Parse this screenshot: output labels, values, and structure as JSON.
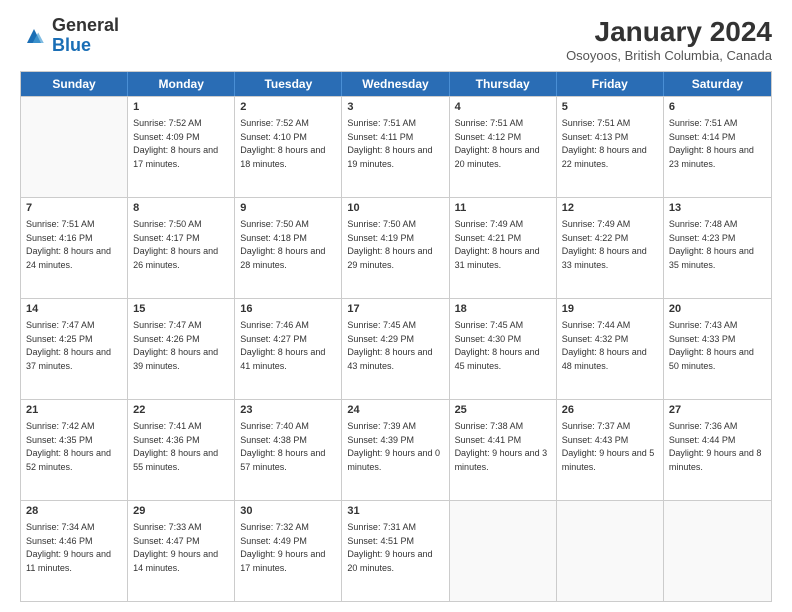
{
  "header": {
    "logo_general": "General",
    "logo_blue": "Blue",
    "month_title": "January 2024",
    "subtitle": "Osoyoos, British Columbia, Canada"
  },
  "weekdays": [
    "Sunday",
    "Monday",
    "Tuesday",
    "Wednesday",
    "Thursday",
    "Friday",
    "Saturday"
  ],
  "rows": [
    [
      {
        "day": "",
        "sunrise": "",
        "sunset": "",
        "daylight": ""
      },
      {
        "day": "1",
        "sunrise": "Sunrise: 7:52 AM",
        "sunset": "Sunset: 4:09 PM",
        "daylight": "Daylight: 8 hours and 17 minutes."
      },
      {
        "day": "2",
        "sunrise": "Sunrise: 7:52 AM",
        "sunset": "Sunset: 4:10 PM",
        "daylight": "Daylight: 8 hours and 18 minutes."
      },
      {
        "day": "3",
        "sunrise": "Sunrise: 7:51 AM",
        "sunset": "Sunset: 4:11 PM",
        "daylight": "Daylight: 8 hours and 19 minutes."
      },
      {
        "day": "4",
        "sunrise": "Sunrise: 7:51 AM",
        "sunset": "Sunset: 4:12 PM",
        "daylight": "Daylight: 8 hours and 20 minutes."
      },
      {
        "day": "5",
        "sunrise": "Sunrise: 7:51 AM",
        "sunset": "Sunset: 4:13 PM",
        "daylight": "Daylight: 8 hours and 22 minutes."
      },
      {
        "day": "6",
        "sunrise": "Sunrise: 7:51 AM",
        "sunset": "Sunset: 4:14 PM",
        "daylight": "Daylight: 8 hours and 23 minutes."
      }
    ],
    [
      {
        "day": "7",
        "sunrise": "Sunrise: 7:51 AM",
        "sunset": "Sunset: 4:16 PM",
        "daylight": "Daylight: 8 hours and 24 minutes."
      },
      {
        "day": "8",
        "sunrise": "Sunrise: 7:50 AM",
        "sunset": "Sunset: 4:17 PM",
        "daylight": "Daylight: 8 hours and 26 minutes."
      },
      {
        "day": "9",
        "sunrise": "Sunrise: 7:50 AM",
        "sunset": "Sunset: 4:18 PM",
        "daylight": "Daylight: 8 hours and 28 minutes."
      },
      {
        "day": "10",
        "sunrise": "Sunrise: 7:50 AM",
        "sunset": "Sunset: 4:19 PM",
        "daylight": "Daylight: 8 hours and 29 minutes."
      },
      {
        "day": "11",
        "sunrise": "Sunrise: 7:49 AM",
        "sunset": "Sunset: 4:21 PM",
        "daylight": "Daylight: 8 hours and 31 minutes."
      },
      {
        "day": "12",
        "sunrise": "Sunrise: 7:49 AM",
        "sunset": "Sunset: 4:22 PM",
        "daylight": "Daylight: 8 hours and 33 minutes."
      },
      {
        "day": "13",
        "sunrise": "Sunrise: 7:48 AM",
        "sunset": "Sunset: 4:23 PM",
        "daylight": "Daylight: 8 hours and 35 minutes."
      }
    ],
    [
      {
        "day": "14",
        "sunrise": "Sunrise: 7:47 AM",
        "sunset": "Sunset: 4:25 PM",
        "daylight": "Daylight: 8 hours and 37 minutes."
      },
      {
        "day": "15",
        "sunrise": "Sunrise: 7:47 AM",
        "sunset": "Sunset: 4:26 PM",
        "daylight": "Daylight: 8 hours and 39 minutes."
      },
      {
        "day": "16",
        "sunrise": "Sunrise: 7:46 AM",
        "sunset": "Sunset: 4:27 PM",
        "daylight": "Daylight: 8 hours and 41 minutes."
      },
      {
        "day": "17",
        "sunrise": "Sunrise: 7:45 AM",
        "sunset": "Sunset: 4:29 PM",
        "daylight": "Daylight: 8 hours and 43 minutes."
      },
      {
        "day": "18",
        "sunrise": "Sunrise: 7:45 AM",
        "sunset": "Sunset: 4:30 PM",
        "daylight": "Daylight: 8 hours and 45 minutes."
      },
      {
        "day": "19",
        "sunrise": "Sunrise: 7:44 AM",
        "sunset": "Sunset: 4:32 PM",
        "daylight": "Daylight: 8 hours and 48 minutes."
      },
      {
        "day": "20",
        "sunrise": "Sunrise: 7:43 AM",
        "sunset": "Sunset: 4:33 PM",
        "daylight": "Daylight: 8 hours and 50 minutes."
      }
    ],
    [
      {
        "day": "21",
        "sunrise": "Sunrise: 7:42 AM",
        "sunset": "Sunset: 4:35 PM",
        "daylight": "Daylight: 8 hours and 52 minutes."
      },
      {
        "day": "22",
        "sunrise": "Sunrise: 7:41 AM",
        "sunset": "Sunset: 4:36 PM",
        "daylight": "Daylight: 8 hours and 55 minutes."
      },
      {
        "day": "23",
        "sunrise": "Sunrise: 7:40 AM",
        "sunset": "Sunset: 4:38 PM",
        "daylight": "Daylight: 8 hours and 57 minutes."
      },
      {
        "day": "24",
        "sunrise": "Sunrise: 7:39 AM",
        "sunset": "Sunset: 4:39 PM",
        "daylight": "Daylight: 9 hours and 0 minutes."
      },
      {
        "day": "25",
        "sunrise": "Sunrise: 7:38 AM",
        "sunset": "Sunset: 4:41 PM",
        "daylight": "Daylight: 9 hours and 3 minutes."
      },
      {
        "day": "26",
        "sunrise": "Sunrise: 7:37 AM",
        "sunset": "Sunset: 4:43 PM",
        "daylight": "Daylight: 9 hours and 5 minutes."
      },
      {
        "day": "27",
        "sunrise": "Sunrise: 7:36 AM",
        "sunset": "Sunset: 4:44 PM",
        "daylight": "Daylight: 9 hours and 8 minutes."
      }
    ],
    [
      {
        "day": "28",
        "sunrise": "Sunrise: 7:34 AM",
        "sunset": "Sunset: 4:46 PM",
        "daylight": "Daylight: 9 hours and 11 minutes."
      },
      {
        "day": "29",
        "sunrise": "Sunrise: 7:33 AM",
        "sunset": "Sunset: 4:47 PM",
        "daylight": "Daylight: 9 hours and 14 minutes."
      },
      {
        "day": "30",
        "sunrise": "Sunrise: 7:32 AM",
        "sunset": "Sunset: 4:49 PM",
        "daylight": "Daylight: 9 hours and 17 minutes."
      },
      {
        "day": "31",
        "sunrise": "Sunrise: 7:31 AM",
        "sunset": "Sunset: 4:51 PM",
        "daylight": "Daylight: 9 hours and 20 minutes."
      },
      {
        "day": "",
        "sunrise": "",
        "sunset": "",
        "daylight": ""
      },
      {
        "day": "",
        "sunrise": "",
        "sunset": "",
        "daylight": ""
      },
      {
        "day": "",
        "sunrise": "",
        "sunset": "",
        "daylight": ""
      }
    ]
  ]
}
